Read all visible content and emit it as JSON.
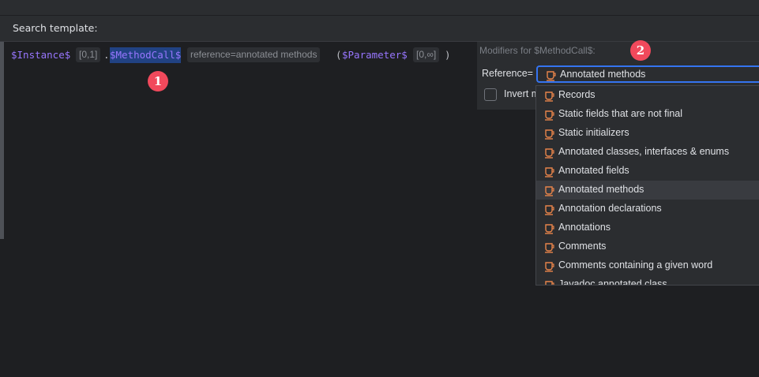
{
  "header": {
    "title": "Search template:"
  },
  "template": {
    "instance_var": "$Instance$",
    "instance_count": "[0,1]",
    "dot": ".",
    "method_var": "$MethodCall$",
    "method_hint": "reference=annotated methods",
    "open_paren": "(",
    "param_var": "$Parameter$",
    "param_count": "[0,∞]",
    "close_paren": ")"
  },
  "badges": {
    "one": "1",
    "two": "2"
  },
  "modifiers": {
    "title": "Modifiers for $MethodCall$:",
    "reference_label": "Reference=",
    "reference_value": "Annotated methods",
    "invert_label": "Invert m"
  },
  "dropdown": {
    "items": [
      "Records",
      "Static fields that are not final",
      "Static initializers",
      "Annotated classes, interfaces & enums",
      "Annotated fields",
      "Annotated methods",
      "Annotation declarations",
      "Annotations",
      "Comments",
      "Comments containing a given word",
      "Javadoc annotated class"
    ],
    "selected": "Annotated methods"
  },
  "colors": {
    "accent": "#3574f0",
    "variable": "#9876ff",
    "badge": "#f1495c",
    "icon": "#e8844a"
  }
}
